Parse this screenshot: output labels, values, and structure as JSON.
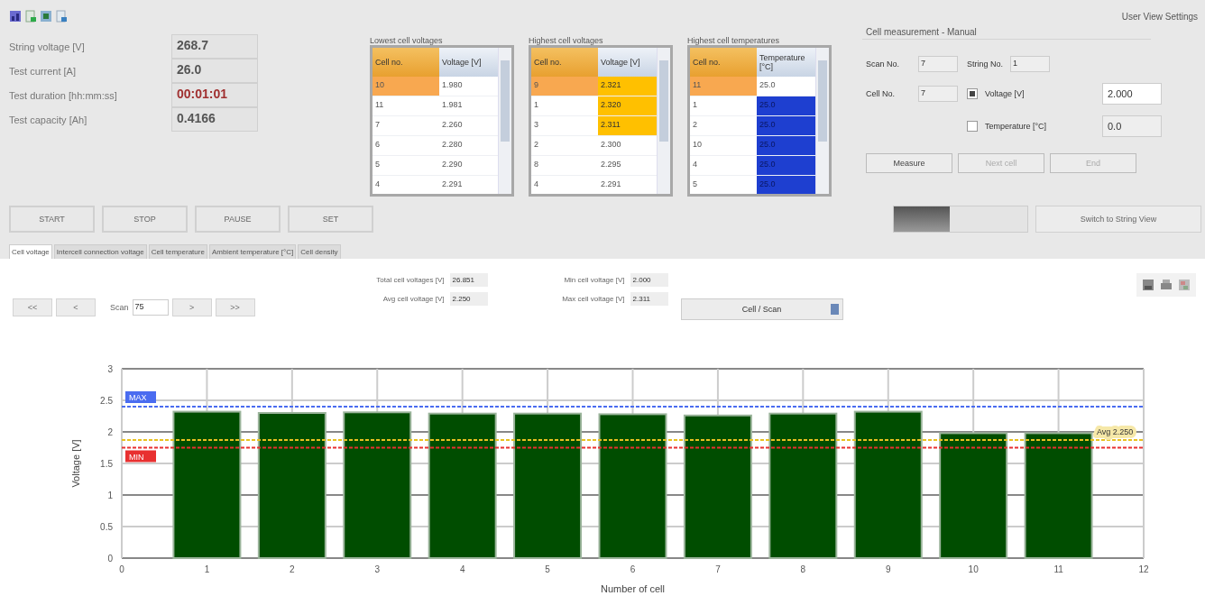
{
  "toolbar": {
    "user_view_settings": "User View Settings"
  },
  "readings": [
    {
      "label": "String voltage [V]",
      "value": "268.7",
      "alert": false
    },
    {
      "label": "Test current [A]",
      "value": "26.0",
      "alert": false
    },
    {
      "label": "Test duration [hh:mm:ss]",
      "value": "00:01:01",
      "alert": true
    },
    {
      "label": "Test capacity [Ah]",
      "value": "0.4166",
      "alert": false
    }
  ],
  "tables": [
    {
      "title": "Lowest cell voltages",
      "kind": "none",
      "columns": [
        "Cell no.",
        "Voltage [V]"
      ],
      "rows": [
        {
          "cells": [
            "10",
            "1.980"
          ],
          "selected": true,
          "highlight": false
        },
        {
          "cells": [
            "11",
            "1.981"
          ],
          "selected": false,
          "highlight": false
        },
        {
          "cells": [
            "7",
            "2.260"
          ],
          "selected": false,
          "highlight": false
        },
        {
          "cells": [
            "6",
            "2.280"
          ],
          "selected": false,
          "highlight": false
        },
        {
          "cells": [
            "5",
            "2.290"
          ],
          "selected": false,
          "highlight": false
        },
        {
          "cells": [
            "4",
            "2.291"
          ],
          "selected": false,
          "highlight": false
        }
      ]
    },
    {
      "title": "Highest cell voltages",
      "kind": "voltage",
      "columns": [
        "Cell no.",
        "Voltage [V]"
      ],
      "rows": [
        {
          "cells": [
            "9",
            "2.321"
          ],
          "selected": true,
          "highlight": true
        },
        {
          "cells": [
            "1",
            "2.320"
          ],
          "selected": false,
          "highlight": true
        },
        {
          "cells": [
            "3",
            "2.311"
          ],
          "selected": false,
          "highlight": true
        },
        {
          "cells": [
            "2",
            "2.300"
          ],
          "selected": false,
          "highlight": false
        },
        {
          "cells": [
            "8",
            "2.295"
          ],
          "selected": false,
          "highlight": false
        },
        {
          "cells": [
            "4",
            "2.291"
          ],
          "selected": false,
          "highlight": false
        }
      ]
    },
    {
      "title": "Highest cell temperatures",
      "kind": "temperature",
      "columns": [
        "Cell no.",
        "Temperature [°C]"
      ],
      "rows": [
        {
          "cells": [
            "11",
            "25.0"
          ],
          "selected": true,
          "highlight": false
        },
        {
          "cells": [
            "1",
            "25.0"
          ],
          "selected": false,
          "highlight": true
        },
        {
          "cells": [
            "2",
            "25.0"
          ],
          "selected": false,
          "highlight": true
        },
        {
          "cells": [
            "10",
            "25.0"
          ],
          "selected": false,
          "highlight": true
        },
        {
          "cells": [
            "4",
            "25.0"
          ],
          "selected": false,
          "highlight": true
        },
        {
          "cells": [
            "5",
            "25.0"
          ],
          "selected": false,
          "highlight": true
        }
      ]
    }
  ],
  "measurement": {
    "title": "Cell measurement - Manual",
    "scan_label": "Scan No.",
    "scan_value": "7",
    "string_label": "String No.",
    "string_value": "1",
    "cell_label": "Cell No.",
    "cell_value": "7",
    "options": [
      {
        "label": "Voltage [V]",
        "checked": true,
        "value": "2.000"
      },
      {
        "label": "Temperature [°C]",
        "checked": false,
        "value": "0.0"
      }
    ],
    "buttons": [
      {
        "label": "Measure",
        "disabled": false
      },
      {
        "label": "Next cell",
        "disabled": true
      },
      {
        "label": "End",
        "disabled": true
      }
    ]
  },
  "controls": [
    {
      "label": "START"
    },
    {
      "label": "STOP"
    },
    {
      "label": "PAUSE"
    },
    {
      "label": "SET"
    }
  ],
  "progress": {
    "level": 0.42
  },
  "switch_button": "Switch to String View",
  "tabs": [
    {
      "label": "Cell voltage",
      "selected": true
    },
    {
      "label": "Intercell connection voltage",
      "selected": false
    },
    {
      "label": "Cell temperature",
      "selected": false
    },
    {
      "label": "Ambient temperature [°C]",
      "selected": false
    },
    {
      "label": "Cell density",
      "selected": false
    }
  ],
  "navigation": {
    "first": "<<",
    "prev": "<",
    "scan_label": "Scan",
    "scan_value": "75",
    "next": ">",
    "last": ">>"
  },
  "stats": [
    {
      "label": "Total cell voltages [V]",
      "value": "26.851"
    },
    {
      "label": "Min cell voltage [V]",
      "value": "2.000"
    },
    {
      "label": "Avg cell voltage [V]",
      "value": "2.250"
    },
    {
      "label": "Max cell voltage [V]",
      "value": "2.311"
    }
  ],
  "view_select": "Cell / Scan",
  "chart_data": {
    "type": "bar",
    "xlabel": "Number of cell",
    "ylabel": "Voltage [V]",
    "x": [
      1,
      2,
      3,
      4,
      5,
      6,
      7,
      8,
      9,
      10,
      11
    ],
    "series": [
      {
        "color": "#004d00",
        "values": [
          2.32,
          2.3,
          2.31,
          2.29,
          2.29,
          2.28,
          2.26,
          2.29,
          2.32,
          1.98,
          1.98
        ]
      }
    ],
    "xlim": [
      0,
      12
    ],
    "ylim": [
      0,
      3
    ],
    "xticks": [
      0,
      1,
      2,
      3,
      4,
      5,
      6,
      7,
      8,
      9,
      10,
      11,
      12
    ],
    "yticks": [
      0,
      0.5,
      1,
      1.5,
      2,
      2.5,
      3
    ],
    "grid": true,
    "ref_lines": [
      {
        "axis": "y",
        "value": 2.4,
        "label": "MAX",
        "color": "#4a6cf0"
      },
      {
        "axis": "y",
        "value": 1.75,
        "label": "MIN",
        "color": "#e83030"
      },
      {
        "axis": "y",
        "value": 1.87,
        "label": "Avg 2.250",
        "color": "#e8c020"
      }
    ]
  }
}
